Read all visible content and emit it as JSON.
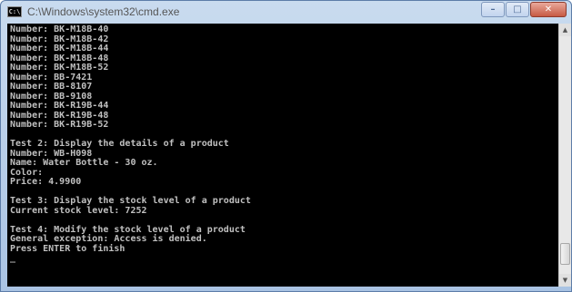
{
  "window": {
    "title": "C:\\Windows\\system32\\cmd.exe",
    "icon_label": "C:\\",
    "controls": {
      "minimize": "–",
      "maximize": "□",
      "close": "✕"
    }
  },
  "console": {
    "lines": [
      "Number: BK-M18B-40",
      "Number: BK-M18B-42",
      "Number: BK-M18B-44",
      "Number: BK-M18B-48",
      "Number: BK-M18B-52",
      "Number: BB-7421",
      "Number: BB-8107",
      "Number: BB-9108",
      "Number: BK-R19B-44",
      "Number: BK-R19B-48",
      "Number: BK-R19B-52",
      "",
      "Test 2: Display the details of a product",
      "Number: WB-H098",
      "Name: Water Bottle - 30 oz.",
      "Color:",
      "Price: 4.9900",
      "",
      "Test 3: Display the stock level of a product",
      "Current stock level: 7252",
      "",
      "Test 4: Modify the stock level of a product",
      "General exception: Access is denied.",
      "Press ENTER to finish",
      "_"
    ]
  },
  "scrollbar": {
    "up_arrow": "▲",
    "down_arrow": "▼",
    "position": 0.96
  },
  "colors": {
    "console_bg": "#000000",
    "console_text": "#c0c0c0",
    "title_bar": "#c9dbef",
    "close_button": "#c75a43"
  }
}
